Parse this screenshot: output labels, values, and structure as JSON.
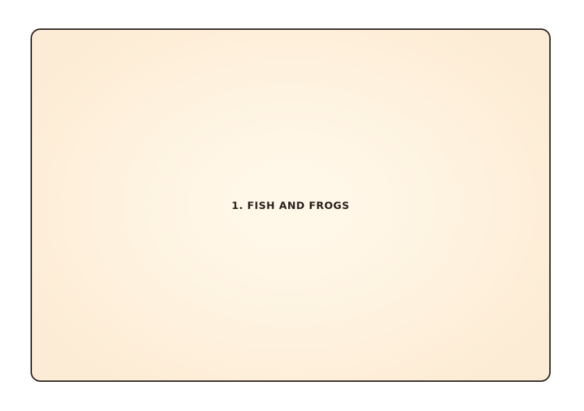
{
  "card": {
    "title": "1. FISH AND FROGS"
  },
  "colors": {
    "border": "#2a211d",
    "text": "#2a211d",
    "background_center": "#fff8e9",
    "background_edge": "#fdecd5",
    "page": "#ffffff"
  }
}
